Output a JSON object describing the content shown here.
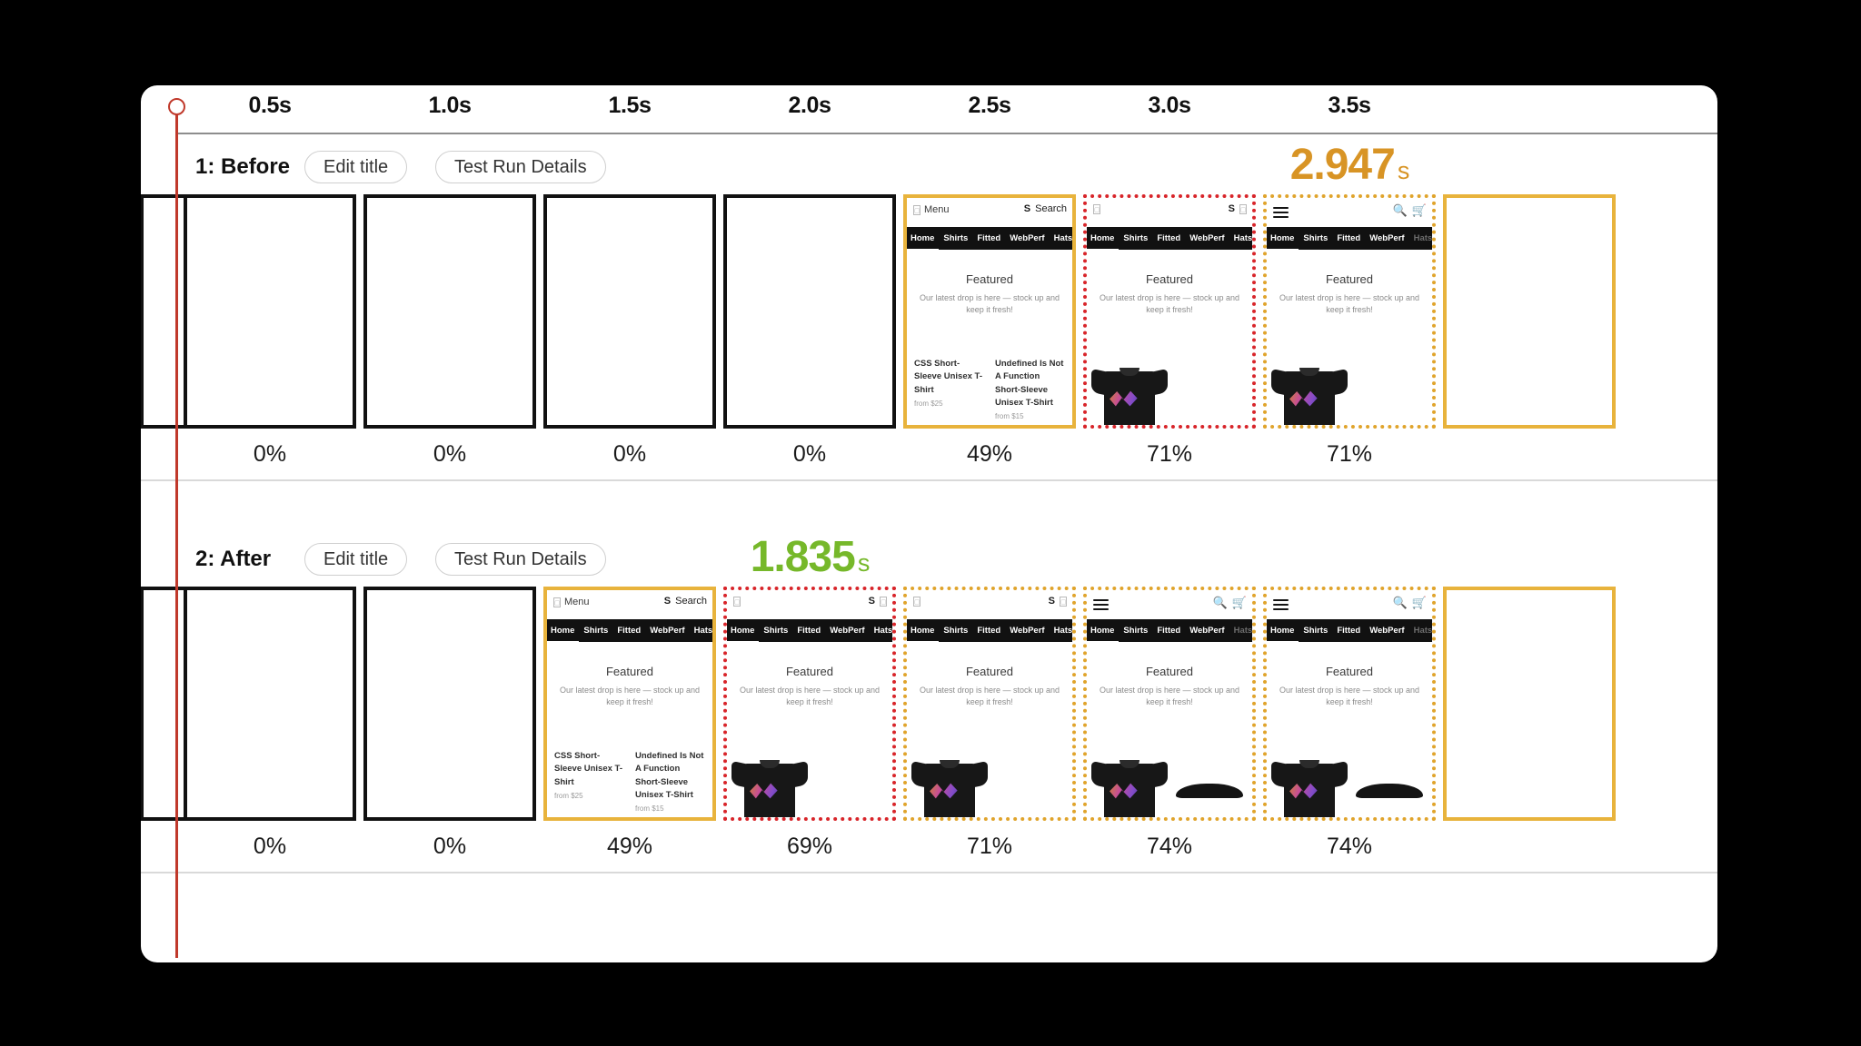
{
  "view": {
    "type": "filmstrip-comparison",
    "background_color": "#000000",
    "card_color": "#ffffff"
  },
  "playhead": {
    "name": "playhead-marker",
    "color": "#c0392b"
  },
  "timeline": {
    "ticks": [
      "0.5s",
      "1.0s",
      "1.5s",
      "2.0s",
      "2.5s",
      "3.0s",
      "3.5s"
    ]
  },
  "colors": {
    "before_time": "#d89425",
    "after_time": "#76b82a",
    "border_black": "#111111",
    "border_amber": "#e8b33c",
    "border_red_dotted": "#d8252a",
    "border_amber_dotted": "#e0a42c"
  },
  "browser_mock": {
    "search_label": "Search",
    "search_prefix": "S",
    "menu_label": "Menu",
    "nav_items": [
      "Home",
      "Shirts",
      "Fitted",
      "WebPerf",
      "Hats"
    ],
    "hero_title": "Featured",
    "hero_sub": "Our latest drop is here — stock up and keep it fresh!",
    "product_1_name": "CSS Short-Sleeve Unisex T-Shirt",
    "product_1_price": "from $25",
    "product_2_name": "Undefined Is Not A Function Short-Sleeve Unisex T-Shirt",
    "product_2_price": "from $15",
    "icons": {
      "hamburger": "hamburger-menu-icon",
      "search": "search-icon",
      "cart": "cart-icon"
    }
  },
  "rows": [
    {
      "id": "before",
      "title": "1: Before",
      "edit_title_label": "Edit title",
      "details_label": "Test Run Details",
      "time_value": "2.947",
      "time_unit": "s",
      "time_color": "#d89425",
      "frames": [
        {
          "pct": "",
          "border": "b-solid-black",
          "content": "blank",
          "clipped": "left"
        },
        {
          "pct": "0%",
          "border": "b-solid-black",
          "content": "blank"
        },
        {
          "pct": "0%",
          "border": "b-solid-black",
          "content": "blank"
        },
        {
          "pct": "0%",
          "border": "b-solid-black",
          "content": "blank"
        },
        {
          "pct": "0%",
          "border": "b-solid-black",
          "content": "blank"
        },
        {
          "pct": "49%",
          "border": "b-solid-amber",
          "content": "text-products",
          "header": "menu-search"
        },
        {
          "pct": "71%",
          "border": "b-dot-red",
          "content": "one-shirt",
          "header": "box-glyphs"
        },
        {
          "pct": "71%",
          "border": "b-dot-amber",
          "content": "one-shirt",
          "header": "icons"
        },
        {
          "pct": "",
          "border": "b-solid-amber",
          "content": "blank",
          "clipped": "right"
        }
      ]
    },
    {
      "id": "after",
      "title": "2: After",
      "edit_title_label": "Edit title",
      "details_label": "Test Run Details",
      "time_value": "1.835",
      "time_unit": "s",
      "time_color": "#76b82a",
      "frames": [
        {
          "pct": "",
          "border": "b-solid-black",
          "content": "blank",
          "clipped": "left"
        },
        {
          "pct": "0%",
          "border": "b-solid-black",
          "content": "blank"
        },
        {
          "pct": "0%",
          "border": "b-solid-black",
          "content": "blank"
        },
        {
          "pct": "49%",
          "border": "b-solid-amber",
          "content": "text-products",
          "header": "menu-search"
        },
        {
          "pct": "69%",
          "border": "b-dot-red",
          "content": "one-shirt",
          "header": "box-glyphs"
        },
        {
          "pct": "71%",
          "border": "b-dot-amber",
          "content": "one-shirt",
          "header": "box-glyphs"
        },
        {
          "pct": "74%",
          "border": "b-dot-amber",
          "content": "two-items",
          "header": "icons"
        },
        {
          "pct": "74%",
          "border": "b-dot-amber",
          "content": "two-items",
          "header": "icons"
        },
        {
          "pct": "",
          "border": "b-solid-amber",
          "content": "blank",
          "clipped": "right"
        }
      ]
    }
  ]
}
